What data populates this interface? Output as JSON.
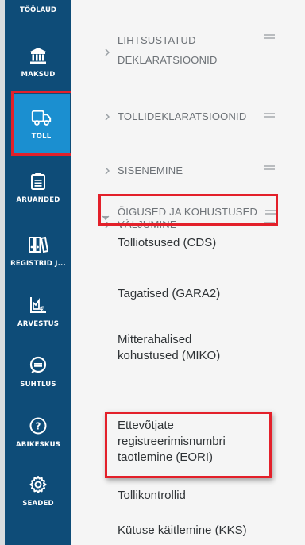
{
  "colors": {
    "rail": "#0e4c78",
    "rail_active": "#1b8fd0",
    "panel": "#f5f5f5",
    "highlight": "#e3202a",
    "section_text": "#6d7277",
    "item_text": "#2f3336"
  },
  "nav": {
    "top_label": "TÖÖLAUD",
    "items": [
      {
        "label": "MAKSUD",
        "icon": "bank-icon",
        "active": false
      },
      {
        "label": "TOLL",
        "icon": "truck-icon",
        "active": true
      },
      {
        "label": "ARUANDED",
        "icon": "clipboard-icon",
        "active": false
      },
      {
        "label": "REGISTRID J...",
        "icon": "binders-icon",
        "active": false
      },
      {
        "label": "ARVESTUS",
        "icon": "chart-euro-icon",
        "active": false
      },
      {
        "label": "SUHTLUS",
        "icon": "chat-icon",
        "active": false
      },
      {
        "label": "ABIKESKUS",
        "icon": "help-icon",
        "active": false
      },
      {
        "label": "SEADED",
        "icon": "gear-icon",
        "active": false
      }
    ]
  },
  "menu": {
    "sections": [
      {
        "label_line1": "LIHTSUSTATUD",
        "label_line2": "DEKLARATSIOONID",
        "expanded": false
      },
      {
        "label": "TOLLIDEKLARATSIOONID",
        "expanded": false
      },
      {
        "label": "SISENEMINE",
        "expanded": false
      },
      {
        "label": "VÄLJUMINE",
        "expanded": false
      },
      {
        "label": "ÕIGUSED JA KOHUSTUSED",
        "expanded": true
      }
    ],
    "sub_items": [
      {
        "label": "Tolliotsused (CDS)"
      },
      {
        "label": "Tagatised (GARA2)"
      },
      {
        "label_line1": "Mitterahalised",
        "label_line2": "kohustused (MIKO)"
      },
      {
        "label_line1": "Ettevõtjate",
        "label_line2": "registreerimisnumbri",
        "label_line3": "taotlemine (EORI)"
      },
      {
        "label": "Tollikontrollid"
      },
      {
        "label": "Kütuse käitlemine (KKS)"
      }
    ]
  }
}
